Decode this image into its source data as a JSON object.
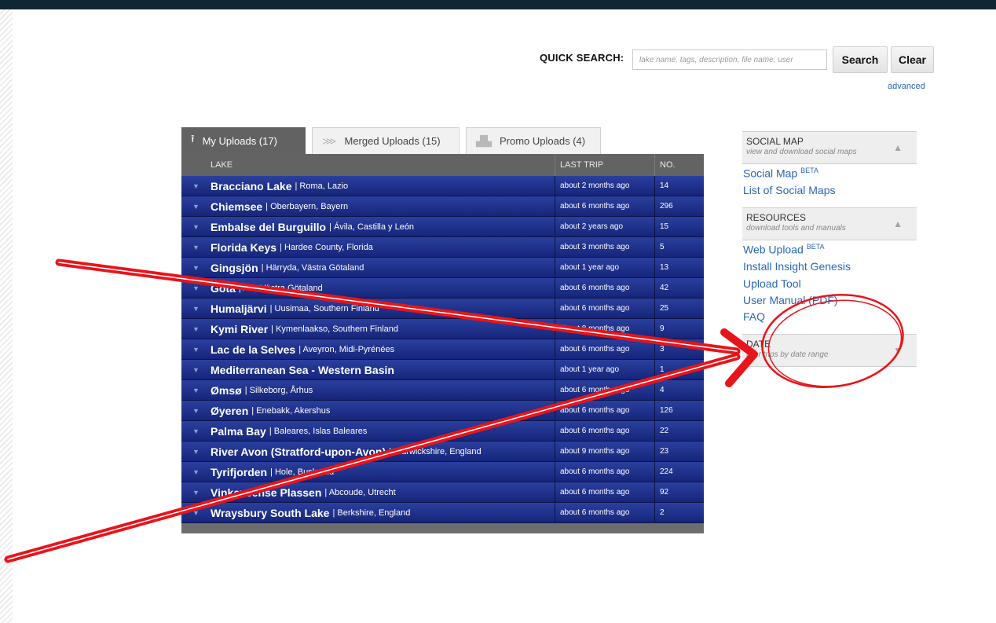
{
  "quick_search": {
    "label": "QUICK SEARCH:",
    "placeholder": "lake name, tags, description, file name, user",
    "search_label": "Search",
    "clear_label": "Clear",
    "advanced_label": "advanced"
  },
  "tabs": [
    {
      "label": "My Uploads (17)",
      "icon": "upload-icon",
      "active": true
    },
    {
      "label": "Merged Uploads (15)",
      "icon": "merge-icon",
      "active": false
    },
    {
      "label": "Promo Uploads (4)",
      "icon": "promo-icon",
      "active": false
    }
  ],
  "table": {
    "headers": {
      "lake": "LAKE",
      "last_trip": "LAST TRIP",
      "no": "NO."
    },
    "rows": [
      {
        "name": "Bracciano Lake",
        "region": "| Roma, Lazio",
        "last_trip": "about 2 months ago",
        "no": "14"
      },
      {
        "name": "Chiemsee",
        "region": "| Oberbayern, Bayern",
        "last_trip": "about 6 months ago",
        "no": "296"
      },
      {
        "name": "Embalse del Burguillo",
        "region": "| Ávila, Castilla y León",
        "last_trip": "about 2 years ago",
        "no": "15"
      },
      {
        "name": "Florida Keys",
        "region": "| Hardee County, Florida",
        "last_trip": "about 3 months ago",
        "no": "5"
      },
      {
        "name": "Gingsjön",
        "region": "| Härryda, Västra Götaland",
        "last_trip": "about 1 year ago",
        "no": "13"
      },
      {
        "name": "Göta",
        "region": "| Ale, Västra Götaland",
        "last_trip": "about 6 months ago",
        "no": "42"
      },
      {
        "name": "Humaljärvi",
        "region": "| Uusimaa, Southern Finland",
        "last_trip": "about 6 months ago",
        "no": "25"
      },
      {
        "name": "Kymi River",
        "region": "| Kymenlaakso, Southern Finland",
        "last_trip": "about 8 months ago",
        "no": "9"
      },
      {
        "name": "Lac de la Selves",
        "region": "| Aveyron, Midi-Pyrénées",
        "last_trip": "about 6 months ago",
        "no": "3"
      },
      {
        "name": "Mediterranean Sea - Western Basin",
        "region": "",
        "last_trip": "about 1 year ago",
        "no": "1"
      },
      {
        "name": "Ømsø",
        "region": "| Silkeborg, Århus",
        "last_trip": "about 6 months ago",
        "no": "4"
      },
      {
        "name": "Øyeren",
        "region": "| Enebakk, Akershus",
        "last_trip": "about 6 months ago",
        "no": "126"
      },
      {
        "name": "Palma Bay",
        "region": "| Baleares, Islas Baleares",
        "last_trip": "about 6 months ago",
        "no": "22"
      },
      {
        "name": "River Avon (Stratford-upon-Avon)",
        "region": "| Warwickshire, England",
        "last_trip": "about 9 months ago",
        "no": "23"
      },
      {
        "name": "Tyrifjorden",
        "region": "| Hole, Buskerud",
        "last_trip": "about 6 months ago",
        "no": "224"
      },
      {
        "name": "Vinkeveense Plassen",
        "region": "| Abcoude, Utrecht",
        "last_trip": "about 6 months ago",
        "no": "92"
      },
      {
        "name": "Wraysbury South Lake",
        "region": "| Berkshire, England",
        "last_trip": "about 6 months ago",
        "no": "2"
      }
    ]
  },
  "sidebar": {
    "social_map": {
      "title": "SOCIAL MAP",
      "subtitle": "view and download social maps",
      "links": [
        {
          "label": "Social Map",
          "sup": "BETA"
        },
        {
          "label": "List of Social Maps",
          "sup": ""
        }
      ]
    },
    "resources": {
      "title": "RESOURCES",
      "subtitle": "download tools and manuals",
      "links": [
        {
          "label": "Web Upload",
          "sup": "BETA"
        },
        {
          "label": "Install Insight Genesis",
          "sup": ""
        },
        {
          "label": "Upload Tool",
          "sup": ""
        },
        {
          "label": "User Manual (PDF)",
          "sup": ""
        },
        {
          "label": "FAQ",
          "sup": ""
        }
      ]
    },
    "date": {
      "title": "DATE",
      "subtitle": "filter trips by date range"
    }
  },
  "colors": {
    "row_blue": "#1c2d88",
    "header_gray": "#636363",
    "link_blue": "#2b66b5",
    "annotation_red": "#e8141b"
  }
}
